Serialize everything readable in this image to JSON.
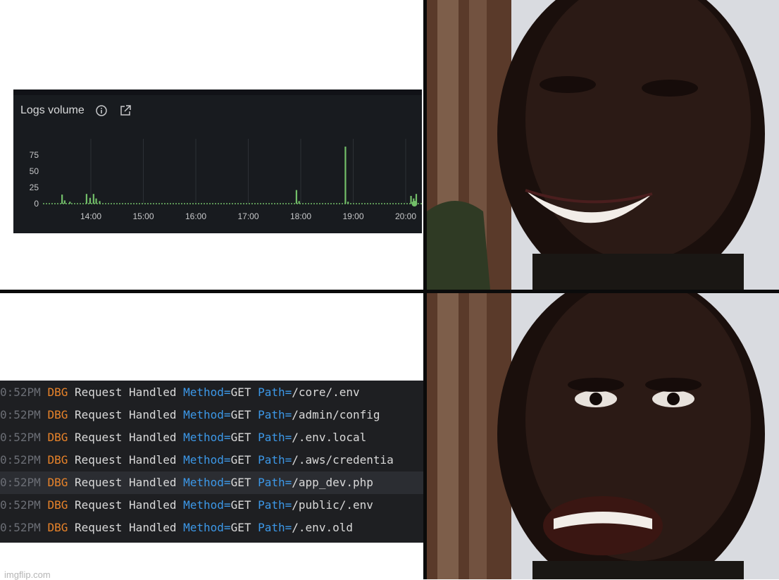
{
  "logs_volume": {
    "title": "Logs volume",
    "info_icon": "info-icon",
    "open_icon": "external-link-icon",
    "accent": "#73bf69",
    "chart_data": {
      "type": "bar",
      "ylim": [
        0,
        100
      ],
      "yticks": [
        "75",
        "50",
        "25",
        "0"
      ],
      "xticks": [
        "14:00",
        "15:00",
        "16:00",
        "17:00",
        "18:00",
        "19:00",
        "20:00"
      ],
      "series": [
        {
          "values": [
            {
              "x": "13:27",
              "y": 14
            },
            {
              "x": "13:30",
              "y": 5
            },
            {
              "x": "13:36",
              "y": 3
            },
            {
              "x": "13:55",
              "y": 15
            },
            {
              "x": "13:59",
              "y": 9
            },
            {
              "x": "14:03",
              "y": 15
            },
            {
              "x": "14:06",
              "y": 8
            },
            {
              "x": "14:10",
              "y": 4
            },
            {
              "x": "17:55",
              "y": 21
            },
            {
              "x": "17:58",
              "y": 4
            },
            {
              "x": "18:51",
              "y": 88
            },
            {
              "x": "18:54",
              "y": 3
            },
            {
              "x": "20:06",
              "y": 12
            },
            {
              "x": "20:09",
              "y": 8
            },
            {
              "x": "20:12",
              "y": 15
            }
          ]
        }
      ]
    }
  },
  "log_lines": [
    {
      "ts": "0:52PM",
      "level": "DBG",
      "msg": "Request Handled",
      "method_key": "Method=",
      "method": "GET",
      "path_key": "Path=",
      "path": "/core/.env"
    },
    {
      "ts": "0:52PM",
      "level": "DBG",
      "msg": "Request Handled",
      "method_key": "Method=",
      "method": "GET",
      "path_key": "Path=",
      "path": "/admin/config"
    },
    {
      "ts": "0:52PM",
      "level": "DBG",
      "msg": "Request Handled",
      "method_key": "Method=",
      "method": "GET",
      "path_key": "Path=",
      "path": "/.env.local"
    },
    {
      "ts": "0:52PM",
      "level": "DBG",
      "msg": "Request Handled",
      "method_key": "Method=",
      "method": "GET",
      "path_key": "Path=",
      "path": "/.aws/credentia"
    },
    {
      "ts": "0:52PM",
      "level": "DBG",
      "msg": "Request Handled",
      "method_key": "Method=",
      "method": "GET",
      "path_key": "Path=",
      "path": "/app_dev.php"
    },
    {
      "ts": "0:52PM",
      "level": "DBG",
      "msg": "Request Handled",
      "method_key": "Method=",
      "method": "GET",
      "path_key": "Path=",
      "path": "/public/.env"
    },
    {
      "ts": "0:52PM",
      "level": "DBG",
      "msg": "Request Handled",
      "method_key": "Method=",
      "method": "GET",
      "path_key": "Path=",
      "path": "/.env.old"
    }
  ],
  "watermark": "imgflip.com"
}
